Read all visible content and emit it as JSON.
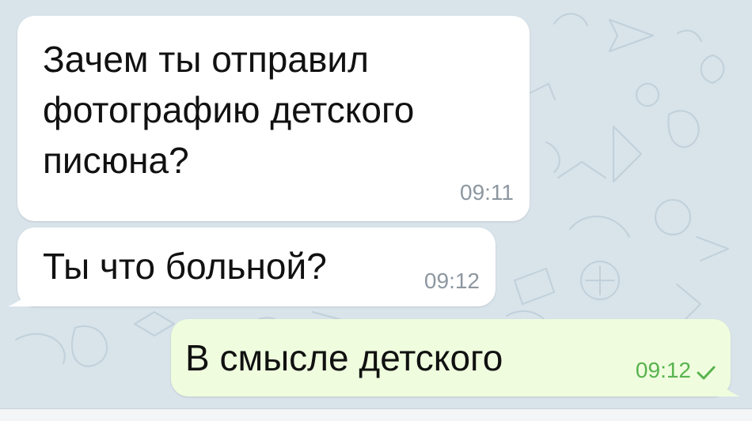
{
  "conversation": {
    "messages": [
      {
        "direction": "incoming",
        "text": "Зачем ты отправил\nфотографию детского\nписюна?",
        "time": "09:11"
      },
      {
        "direction": "incoming",
        "text": "Ты что больной?",
        "time": "09:12"
      },
      {
        "direction": "outgoing",
        "text": "В смысле детского",
        "time": "09:12",
        "status_icon": "single-check-icon"
      }
    ]
  },
  "colors": {
    "chat_background": "#d8e3ea",
    "incoming_bubble": "#ffffff",
    "outgoing_bubble": "#effdde",
    "incoming_time": "#8d97a0",
    "outgoing_time_and_check": "#58b34e"
  }
}
